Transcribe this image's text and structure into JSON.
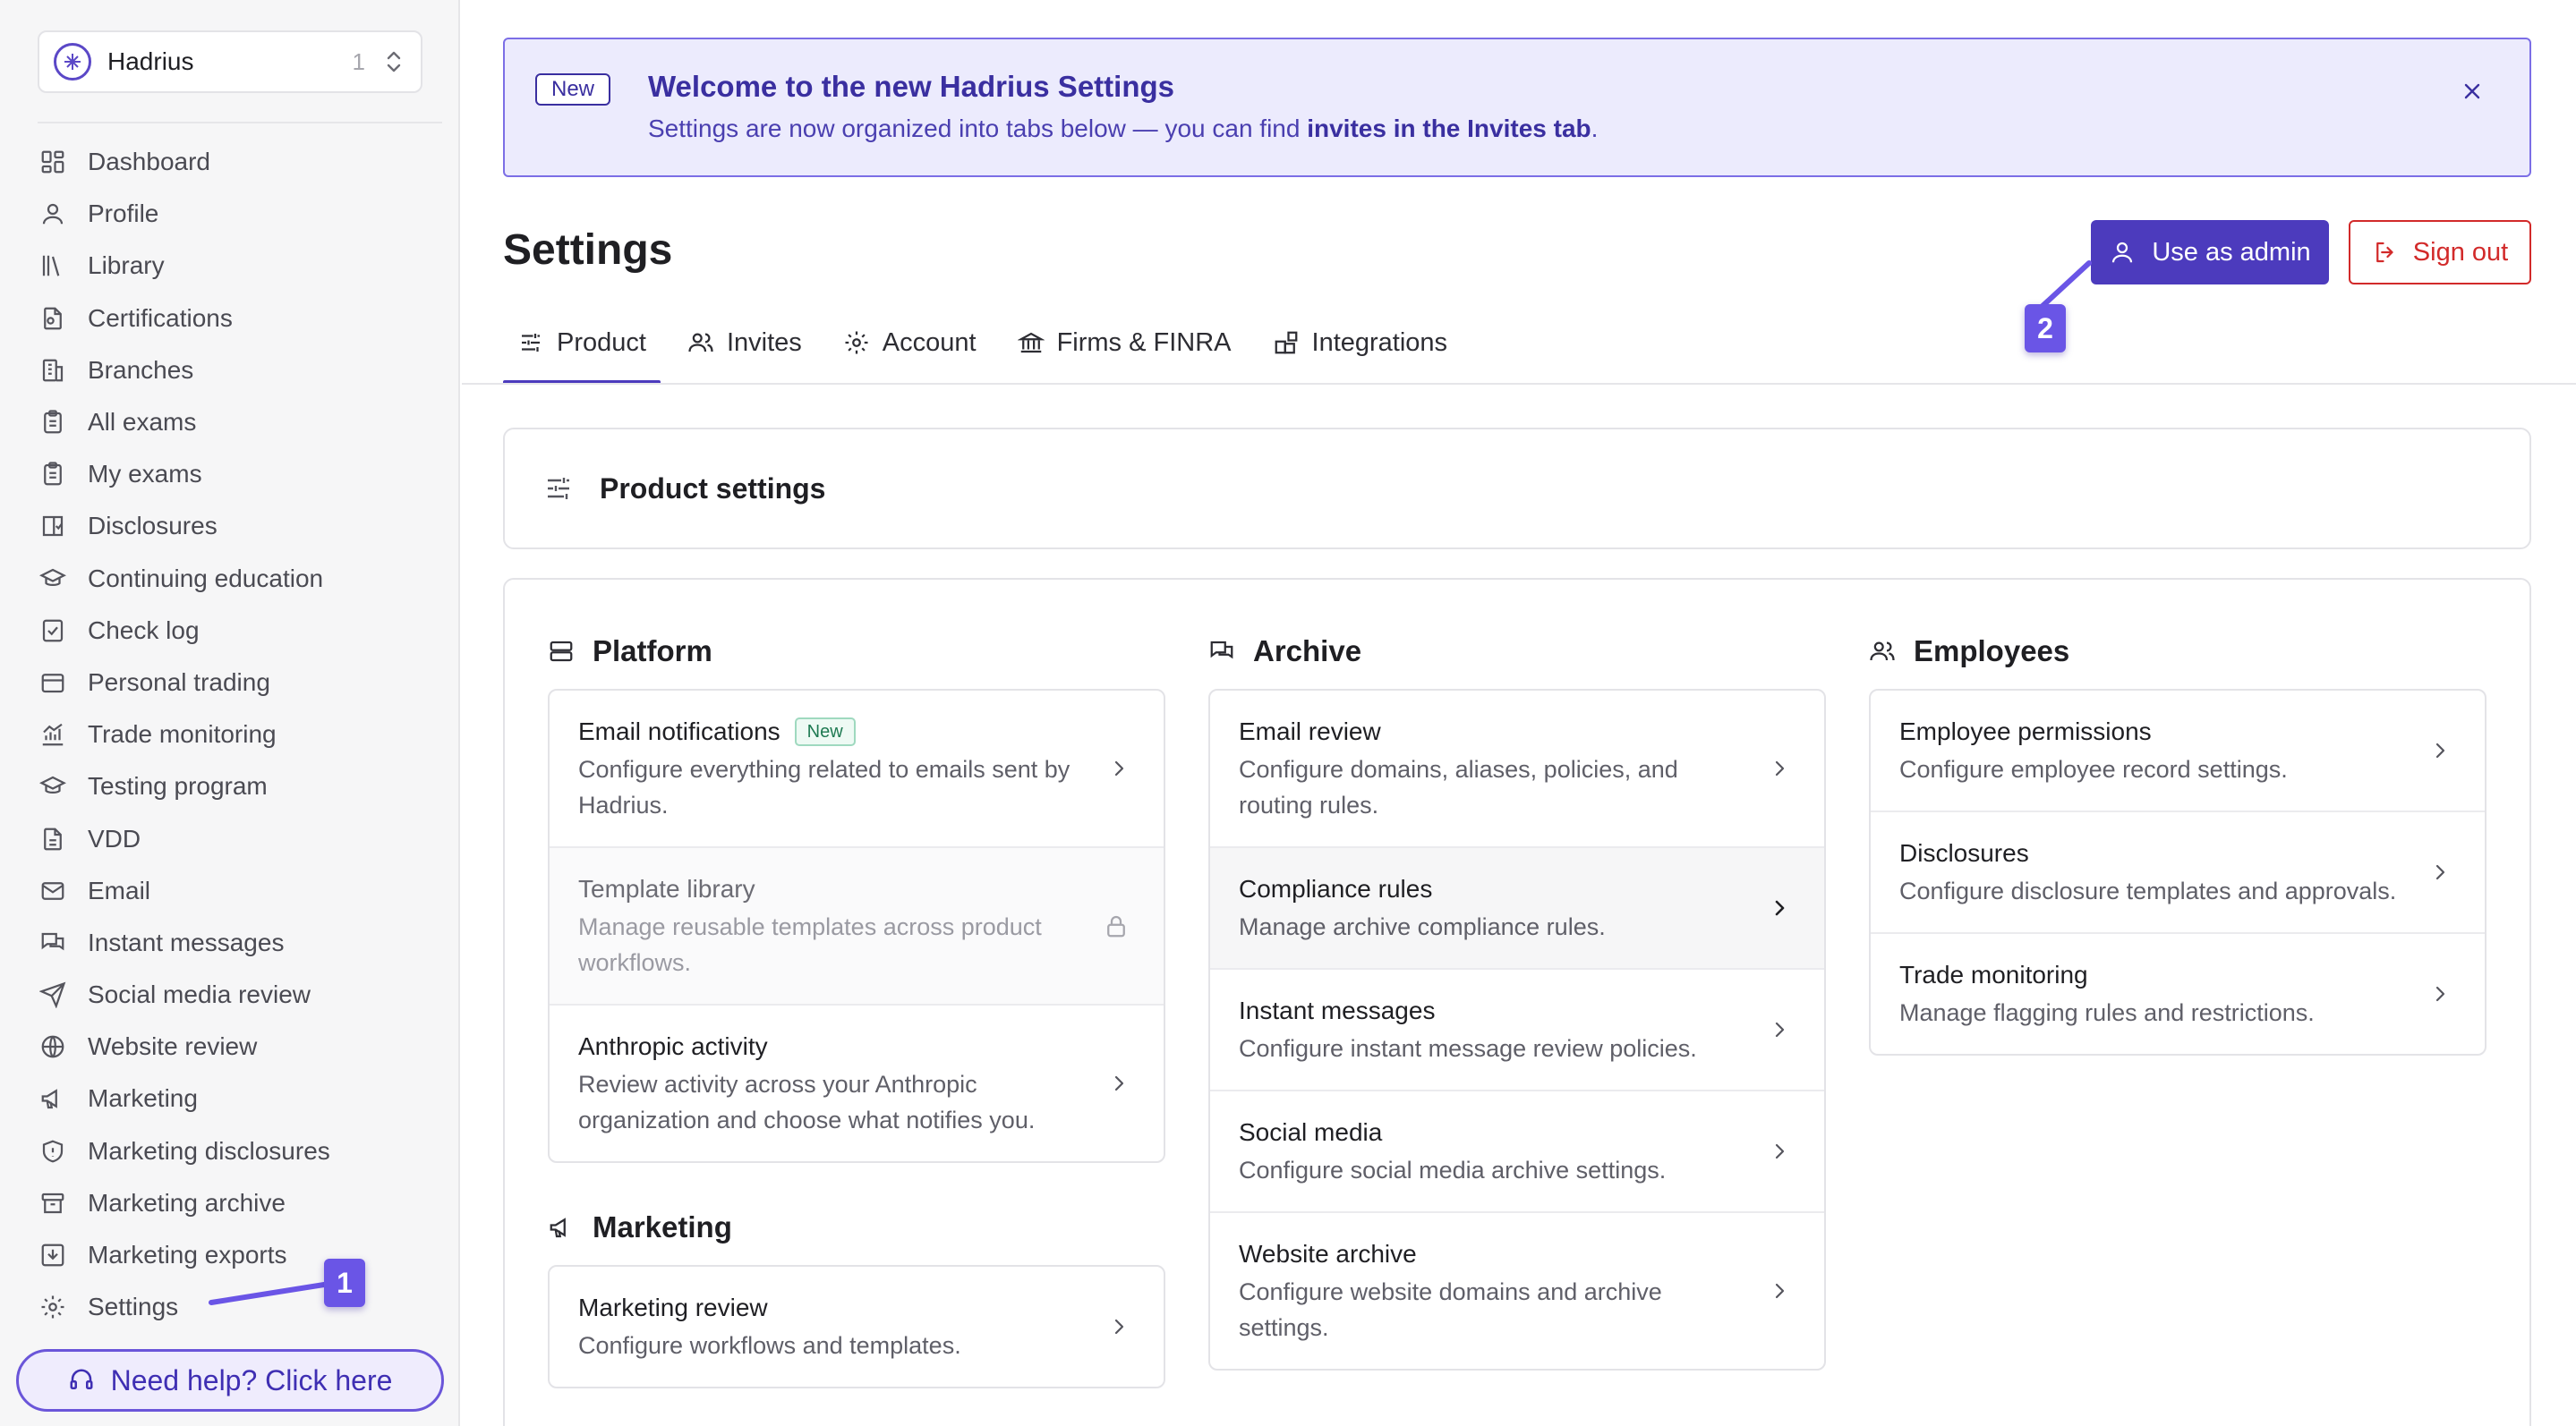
{
  "org": {
    "name": "Hadrius",
    "count": "1"
  },
  "sidebar": {
    "items": [
      {
        "label": "Dashboard",
        "icon": "dashboard-icon"
      },
      {
        "label": "Profile",
        "icon": "user-icon"
      },
      {
        "label": "Library",
        "icon": "library-icon"
      },
      {
        "label": "Certifications",
        "icon": "certificate-icon"
      },
      {
        "label": "Branches",
        "icon": "building-icon"
      },
      {
        "label": "All exams",
        "icon": "clipboard-icon"
      },
      {
        "label": "My exams",
        "icon": "clipboard-icon"
      },
      {
        "label": "Disclosures",
        "icon": "book-check-icon"
      },
      {
        "label": "Continuing education",
        "icon": "graduation-cap-icon"
      },
      {
        "label": "Check log",
        "icon": "check-square-icon"
      },
      {
        "label": "Personal trading",
        "icon": "wallet-icon"
      },
      {
        "label": "Trade monitoring",
        "icon": "chart-icon"
      },
      {
        "label": "Testing program",
        "icon": "graduation-cap-icon"
      },
      {
        "label": "VDD",
        "icon": "file-icon"
      },
      {
        "label": "Email",
        "icon": "mail-icon"
      },
      {
        "label": "Instant messages",
        "icon": "messages-icon"
      },
      {
        "label": "Social media review",
        "icon": "send-icon"
      },
      {
        "label": "Website review",
        "icon": "globe-icon"
      },
      {
        "label": "Marketing",
        "icon": "megaphone-icon"
      },
      {
        "label": "Marketing disclosures",
        "icon": "shield-icon"
      },
      {
        "label": "Marketing archive",
        "icon": "archive-icon"
      },
      {
        "label": "Marketing exports",
        "icon": "download-icon"
      },
      {
        "label": "Settings",
        "icon": "gear-icon"
      }
    ],
    "help_label": "Need help? Click here"
  },
  "banner": {
    "badge": "New",
    "title": "Welcome to the new Hadrius Settings",
    "text_before": "Settings are now organized into tabs below — you can find ",
    "text_bold": "invites in the Invites tab",
    "text_after": "."
  },
  "header": {
    "title": "Settings",
    "admin_label": "Use as admin",
    "signout_label": "Sign out"
  },
  "tabs": [
    {
      "label": "Product",
      "icon": "sliders-icon",
      "active": true
    },
    {
      "label": "Invites",
      "icon": "users-icon",
      "active": false
    },
    {
      "label": "Account",
      "icon": "gear-icon",
      "active": false
    },
    {
      "label": "Firms & FINRA",
      "icon": "bank-icon",
      "active": false
    },
    {
      "label": "Integrations",
      "icon": "blocks-icon",
      "active": false
    }
  ],
  "section": {
    "title": "Product settings"
  },
  "columns": {
    "platform": {
      "title": "Platform",
      "rows": [
        {
          "title": "Email notifications",
          "badge": "New",
          "desc": "Configure everything related to emails sent by Hadrius."
        },
        {
          "title": "Template library",
          "desc": "Manage reusable templates across product workflows."
        },
        {
          "title": "Anthropic activity",
          "desc": "Review activity across your Anthropic organization and choose what notifies you."
        }
      ]
    },
    "marketing": {
      "title": "Marketing",
      "rows": [
        {
          "title": "Marketing review",
          "desc": "Configure workflows and templates."
        }
      ]
    },
    "archive": {
      "title": "Archive",
      "rows": [
        {
          "title": "Email review",
          "desc": "Configure domains, aliases, policies, and routing rules."
        },
        {
          "title": "Compliance rules",
          "desc": "Manage archive compliance rules."
        },
        {
          "title": "Instant messages",
          "desc": "Configure instant message review policies."
        },
        {
          "title": "Social media",
          "desc": "Configure social media archive settings."
        },
        {
          "title": "Website archive",
          "desc": "Configure website domains and archive settings."
        }
      ]
    },
    "employees": {
      "title": "Employees",
      "rows": [
        {
          "title": "Employee permissions",
          "desc": "Configure employee record settings."
        },
        {
          "title": "Disclosures",
          "desc": "Configure disclosure templates and approvals."
        },
        {
          "title": "Trade monitoring",
          "desc": "Manage flagging rules and restrictions."
        }
      ]
    }
  },
  "annotations": {
    "marker_1": "1",
    "marker_2": "2"
  },
  "colors": {
    "accent": "#4c3bbd",
    "danger": "#d22a2a",
    "banner_bg": "#ecebfd",
    "marker": "#6a55e6"
  }
}
